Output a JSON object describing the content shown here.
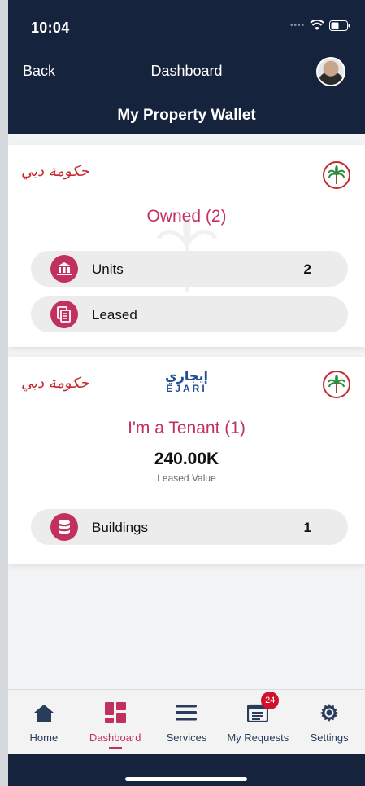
{
  "status_bar": {
    "time": "10:04"
  },
  "header": {
    "back_label": "Back",
    "title": "Dashboard",
    "page_title": "My Property Wallet"
  },
  "owned_card": {
    "heading": "Owned  (2)",
    "rows": [
      {
        "label": "Units",
        "count": "2",
        "icon": "building-icon"
      },
      {
        "label": "Leased",
        "count": "",
        "icon": "documents-icon"
      }
    ]
  },
  "tenant_card": {
    "heading": "I'm a Tenant  (1)",
    "ejari_arabic": "إيجاري",
    "ejari_english": "EJARI",
    "leased_value": "240.00K",
    "leased_label": "Leased Value",
    "rows": [
      {
        "label": "Buildings",
        "count": "1",
        "icon": "database-icon"
      }
    ]
  },
  "logos": {
    "government": "حكومة دبي"
  },
  "tabs": [
    {
      "label": "Home",
      "icon": "home-icon",
      "active": false
    },
    {
      "label": "Dashboard",
      "icon": "dashboard-icon",
      "active": true
    },
    {
      "label": "Services",
      "icon": "menu-icon",
      "active": false
    },
    {
      "label": "My Requests",
      "icon": "requests-icon",
      "active": false,
      "badge": "24"
    },
    {
      "label": "Settings",
      "icon": "gear-icon",
      "active": false
    }
  ],
  "colors": {
    "header": "#15233d",
    "accent": "#c2305d",
    "badge": "#d0112b",
    "tab_inactive": "#2a3c5c"
  }
}
